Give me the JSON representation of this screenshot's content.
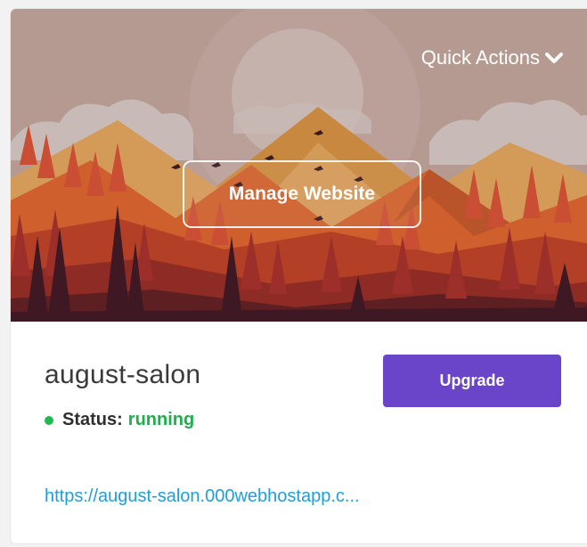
{
  "card": {
    "hero": {
      "quick_actions_label": "Quick Actions",
      "quick_actions_icon": "chevron-down-icon",
      "manage_label": "Manage Website"
    },
    "site_name": "august-salon",
    "status": {
      "label": "Status:",
      "value": "running",
      "indicator_color": "#1fba4f"
    },
    "upgrade_label": "Upgrade",
    "url": "https://august-salon.000webhostapp.c..."
  },
  "colors": {
    "accent": "#6a44c9",
    "link": "#1e9fd8",
    "status_running": "#1fae4c"
  }
}
